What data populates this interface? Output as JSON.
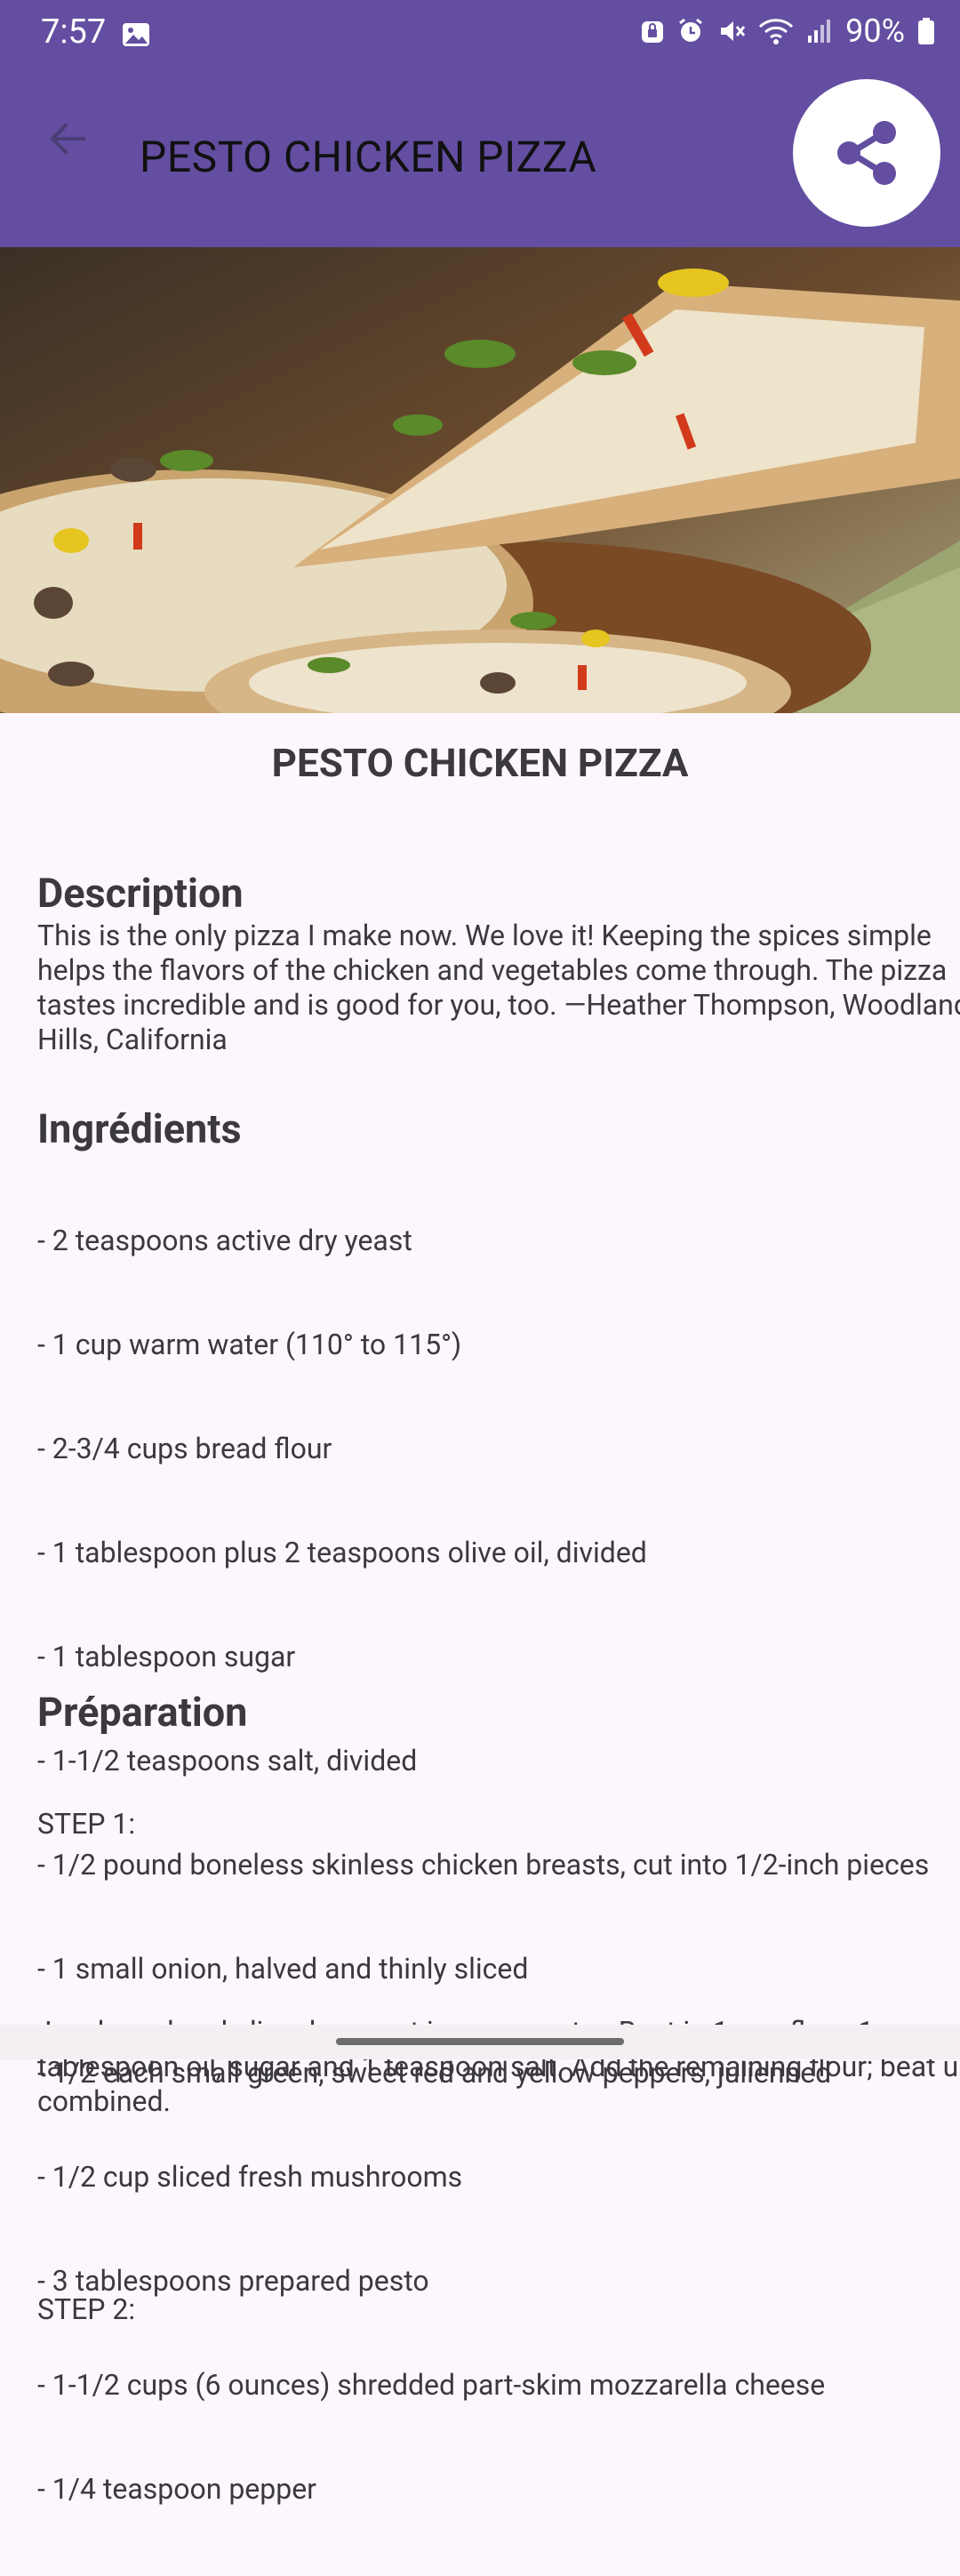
{
  "status_bar": {
    "time": "7:57",
    "battery": "90%"
  },
  "toolbar": {
    "title": "PESTO CHICKEN PIZZA",
    "back_icon": "arrow-left-icon",
    "share_icon": "share-icon",
    "color": "#634ea1"
  },
  "recipe": {
    "name": "PESTO CHICKEN PIZZA",
    "description_heading": "Description",
    "description": "This is the only pizza I make now. We love it! Keeping the spices simple helps the flavors of the chicken and vegetables come through. The pizza tastes incredible and is good for you, too. —Heather Thompson, Woodland Hills, California",
    "ingredients_heading": "Ingrédients",
    "ingredients": [
      "- 2 teaspoons active dry yeast",
      "- 1 cup warm water (110° to 115°)",
      "- 2-3/4 cups bread flour",
      "- 1 tablespoon plus 2 teaspoons olive oil, divided",
      "- 1 tablespoon sugar",
      "- 1-1/2 teaspoons salt, divided",
      "- 1/2 pound boneless skinless chicken breasts, cut into 1/2-inch pieces",
      "- 1 small onion, halved and thinly sliced",
      "- 1/2 each small green, sweet red and yellow peppers, julienned",
      "- 1/2 cup sliced fresh mushrooms",
      "- 3 tablespoons prepared pesto",
      "- 1-1/2 cups (6 ounces) shredded part-skim mozzarella cheese",
      "- 1/4 teaspoon pepper"
    ],
    "preparation_heading": "Préparation",
    "steps": [
      {
        "label": "STEP 1:",
        "text": " In a large bowl, dissolve yeast in warm water. Beat in 1 cup flour, 1 tablespoon oil, sugar and 1 teaspoon salt. Add the remaining flour; beat until combined."
      },
      {
        "label": "STEP 2:",
        "text": ""
      }
    ]
  }
}
